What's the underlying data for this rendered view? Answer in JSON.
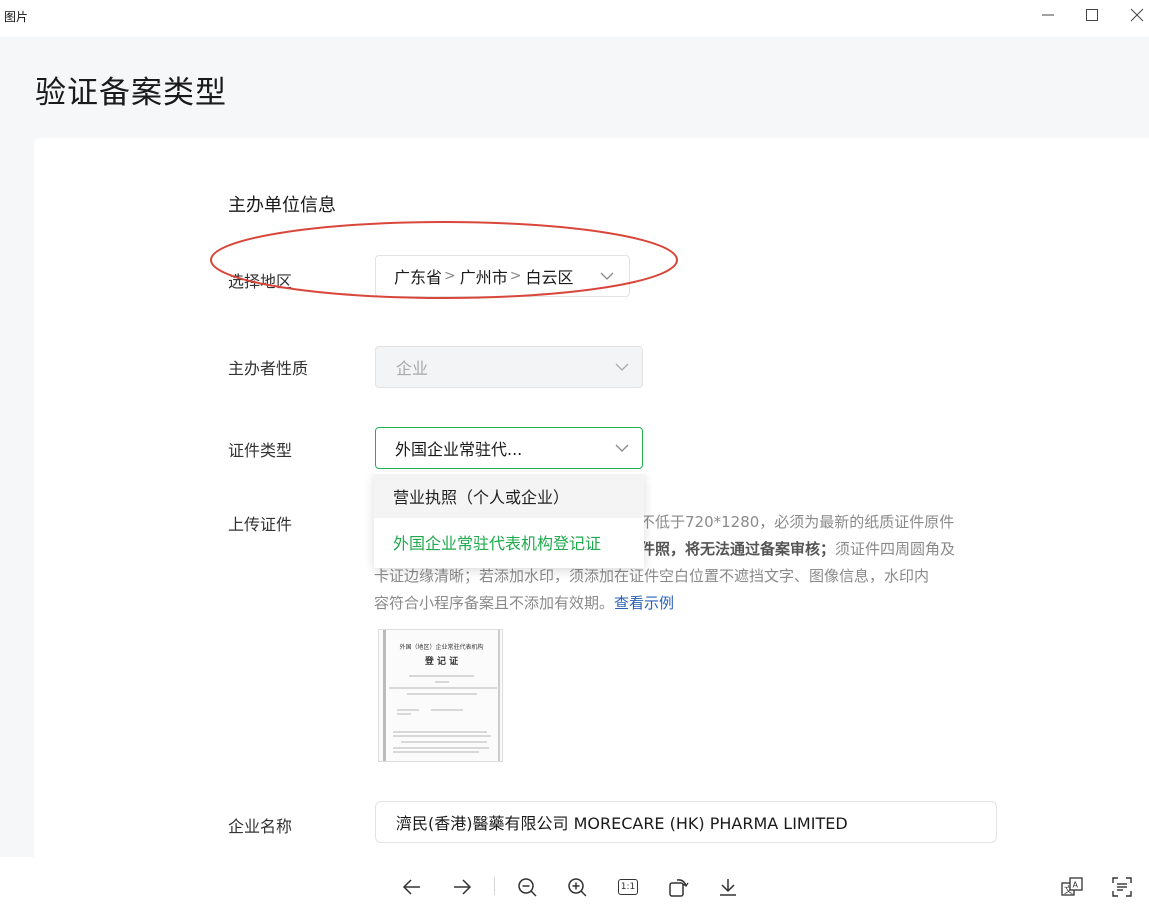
{
  "window": {
    "title": "图片"
  },
  "page": {
    "title": "验证备案类型"
  },
  "form": {
    "section_title": "主办单位信息",
    "region": {
      "label": "选择地区",
      "province": "广东省",
      "city": "广州市",
      "district": "白云区",
      "separator": ">"
    },
    "nature": {
      "label": "主办者性质",
      "value": "企业"
    },
    "cert_type": {
      "label": "证件类型",
      "value": "外国企业常驻代...",
      "options": [
        "营业执照（个人或企业）",
        "外国企业常驻代表机构登记证"
      ]
    },
    "upload": {
      "label": "上传证件",
      "hint_line1": "不低于720*1280，必须为最新的纸质证件原件",
      "hint_line2_bold": "件照，将无法通过备案审核；",
      "hint_line2_rest": "须证件四周圆角及",
      "hint_line3": "卡证边缘清晰；若添加水印，须添加在证件空白位置不遮挡文字、图像信息，水印内",
      "hint_line4": "容符合小程序备案且不添加有效期。",
      "hint_link": "查看示例",
      "sample_heading1": "外国（地区）企业常驻代表机构",
      "sample_heading2": "登 记 证"
    },
    "company": {
      "label": "企业名称",
      "value": "濟民(香港)醫藥有限公司 MORECARE (HK) PHARMA LIMITED"
    }
  },
  "colors": {
    "accent": "#22b04f",
    "annotation": "#d9473b",
    "link": "#2a62b8"
  },
  "toolbar": {
    "actual_size_label": "1:1"
  },
  "icons": [
    "minimize-icon",
    "maximize-icon",
    "close-icon",
    "chevron-down-icon",
    "arrow-left-icon",
    "arrow-right-icon",
    "zoom-out-icon",
    "zoom-in-icon",
    "rotate-icon",
    "download-icon",
    "translate-icon",
    "ocr-text-icon"
  ]
}
